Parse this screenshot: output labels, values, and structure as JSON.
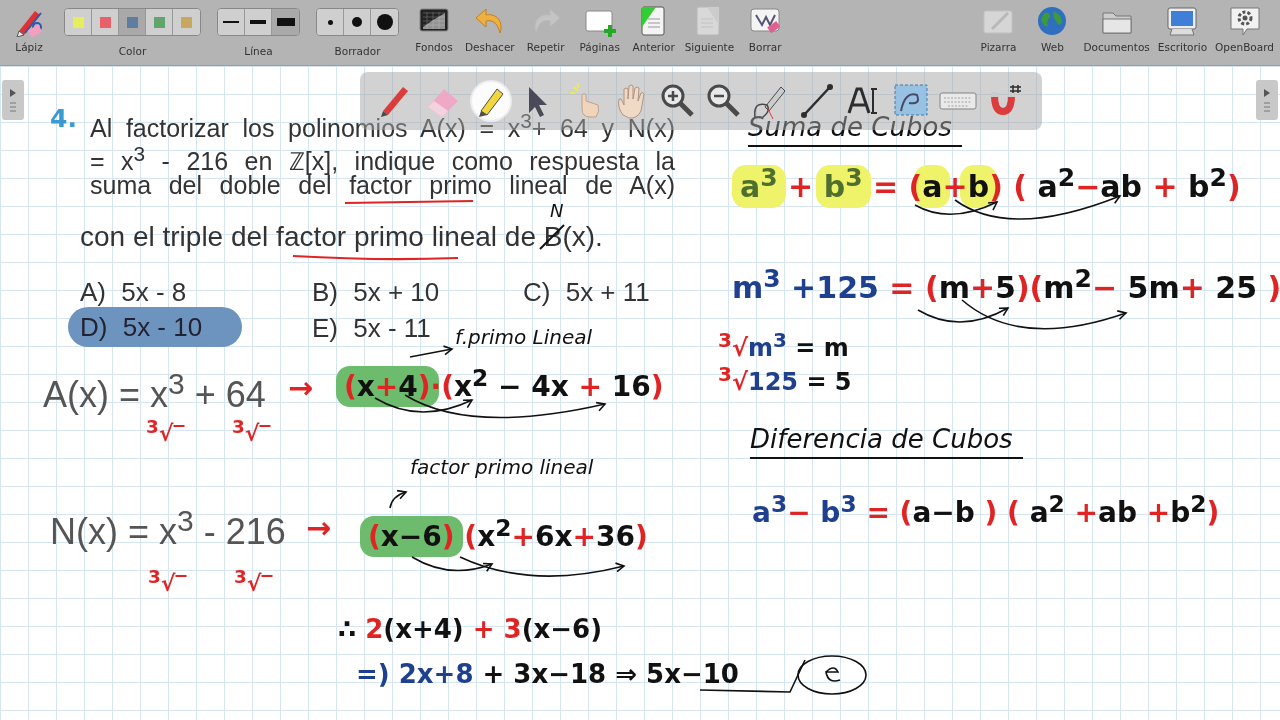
{
  "toolbar": {
    "left": [
      {
        "kind": "button",
        "label": "Lápiz",
        "disabled": false
      },
      {
        "kind": "colors",
        "label": "Color",
        "options": [
          {
            "color": "#e6ee5c",
            "selected": false
          },
          {
            "color": "#e8606a",
            "selected": false
          },
          {
            "color": "#5f7d9f",
            "selected": true
          },
          {
            "color": "#62a56c",
            "selected": false
          },
          {
            "color": "#c9a760",
            "selected": false
          }
        ]
      },
      {
        "kind": "line_widths",
        "label": "Línea",
        "options": [
          {
            "selected": false
          },
          {
            "selected": false
          },
          {
            "selected": true
          }
        ]
      },
      {
        "kind": "eraser_sizes",
        "label": "Borrador",
        "options": [
          {
            "selected": false
          },
          {
            "selected": false
          },
          {
            "selected": false
          }
        ]
      },
      {
        "kind": "button",
        "label": "Fondos",
        "disabled": false
      },
      {
        "kind": "button",
        "label": "Deshacer",
        "disabled": false
      },
      {
        "kind": "button",
        "label": "Repetir",
        "disabled": true
      },
      {
        "kind": "button",
        "label": "Páginas",
        "disabled": false
      },
      {
        "kind": "button",
        "label": "Anterior",
        "disabled": false
      },
      {
        "kind": "button",
        "label": "Siguiente",
        "disabled": true
      },
      {
        "kind": "button",
        "label": "Borrar",
        "disabled": false
      }
    ],
    "right": [
      {
        "kind": "button",
        "label": "Pizarra",
        "disabled": true
      },
      {
        "kind": "button",
        "label": "Web",
        "disabled": false
      },
      {
        "kind": "button",
        "label": "Documentos",
        "disabled": false
      },
      {
        "kind": "button",
        "label": "Escritorio",
        "disabled": false
      },
      {
        "kind": "button",
        "label": "OpenBoard",
        "disabled": false
      }
    ]
  },
  "tools": [
    {
      "selected": false
    },
    {
      "selected": false
    },
    {
      "selected": true
    },
    {
      "selected": false
    },
    {
      "selected": false
    },
    {
      "selected": false
    },
    {
      "selected": false
    },
    {
      "selected": false
    },
    {
      "selected": false
    },
    {
      "selected": false
    },
    {
      "selected": false
    },
    {
      "selected": false
    },
    {
      "selected": false
    },
    {
      "selected": false
    }
  ],
  "question": {
    "number": "4.",
    "lines": [
      "Al factorizar los polinomios A(x) = x$^{3}$+ 64 y N(x)",
      "= x$^{3}$ - 216 en ℤ[x], indique como respuesta la",
      "suma del doble del factor primo lineal de A(x)",
      "con el triple del factor primo lineal de B(x)."
    ]
  },
  "options": [
    {
      "letter": "A)",
      "text": "5x - 8",
      "selected": false
    },
    {
      "letter": "B)",
      "text": "5x + 10",
      "selected": false
    },
    {
      "letter": "C)",
      "text": "5x + 11",
      "selected": false
    },
    {
      "letter": "D)",
      "text": "5x - 10",
      "selected": true
    },
    {
      "letter": "E)",
      "text": "5x - 11",
      "selected": false
    }
  ],
  "ink": [
    {
      "kind": "note",
      "parts": [
        {
          "text": "N",
          "color": "#111111"
        }
      ]
    },
    {
      "kind": "note",
      "parts": [
        {
          "text": "f.primo Lineal",
          "color": "#111111"
        }
      ]
    },
    {
      "kind": "printed",
      "text": "A(x) = x$^{3}$ + 64"
    },
    {
      "kind": "math",
      "parts": [
        {
          "text": "→",
          "color": "#e02424"
        }
      ]
    },
    {
      "kind": "math",
      "parts": [
        {
          "text": "(",
          "color": "#e02424"
        },
        {
          "text": "x",
          "color": "#111111"
        },
        {
          "text": "+",
          "color": "#e02424"
        },
        {
          "text": "4",
          "color": "#111111"
        },
        {
          "text": ")",
          "color": "#e02424"
        },
        {
          "text": "·(",
          "color": "#e02424"
        },
        {
          "text": "x$^{2}$ − 4x ",
          "color": "#111111"
        },
        {
          "text": "+",
          "color": "#e02424"
        },
        {
          "text": " 16",
          "color": "#111111"
        },
        {
          "text": ")",
          "color": "#e02424"
        }
      ]
    },
    {
      "kind": "math",
      "parts": [
        {
          "text": "$^{3}$√‾",
          "color": "#e02424"
        }
      ]
    },
    {
      "kind": "math",
      "parts": [
        {
          "text": "$^{3}$√‾",
          "color": "#e02424"
        }
      ]
    },
    {
      "kind": "note",
      "parts": [
        {
          "text": "factor primo lineal",
          "color": "#111111"
        }
      ]
    },
    {
      "kind": "printed",
      "text": "N(x) = x$^{3}$ - 216"
    },
    {
      "kind": "math",
      "parts": [
        {
          "text": "→",
          "color": "#e02424"
        }
      ]
    },
    {
      "kind": "math",
      "parts": [
        {
          "text": "(",
          "color": "#e02424"
        },
        {
          "text": "x−6",
          "color": "#111111"
        },
        {
          "text": ")",
          "color": "#e02424"
        },
        {
          "text": " (",
          "color": "#e02424"
        },
        {
          "text": "x$^{2}$",
          "color": "#111111"
        },
        {
          "text": "+",
          "color": "#e02424"
        },
        {
          "text": "6x",
          "color": "#111111"
        },
        {
          "text": "+",
          "color": "#e02424"
        },
        {
          "text": "36",
          "color": "#111111"
        },
        {
          "text": ")",
          "color": "#e02424"
        }
      ]
    },
    {
      "kind": "math",
      "parts": [
        {
          "text": "$^{3}$√‾",
          "color": "#e02424"
        }
      ]
    },
    {
      "kind": "math",
      "parts": [
        {
          "text": "$^{3}$√‾",
          "color": "#e02424"
        }
      ]
    },
    {
      "kind": "math",
      "parts": [
        {
          "text": "∴ ",
          "color": "#111111"
        },
        {
          "text": "2",
          "color": "#e02424"
        },
        {
          "text": "(x+4) ",
          "color": "#111111"
        },
        {
          "text": "+ 3",
          "color": "#e02424"
        },
        {
          "text": "(x−6)",
          "color": "#111111"
        }
      ]
    },
    {
      "kind": "math",
      "parts": [
        {
          "text": "=) ",
          "color": "#1f3f8f"
        },
        {
          "text": "2x+8",
          "color": "#1f3f8f"
        },
        {
          "text": " + 3x−18",
          "color": "#111111"
        },
        {
          "text": "   ⇒ 5x−10",
          "color": "#111111"
        }
      ]
    },
    {
      "kind": "heading",
      "parts": [
        {
          "text": "Suma de Cubos",
          "color": "#111111"
        }
      ]
    },
    {
      "kind": "math",
      "parts": [
        {
          "text": "a$^{3}$",
          "color": "#4f6f2f"
        },
        {
          "text": " + ",
          "color": "#e02424"
        },
        {
          "text": "b$^{3}$",
          "color": "#4f6f2f"
        },
        {
          "text": " = (",
          "color": "#e02424"
        },
        {
          "text": "a",
          "color": "#111111"
        },
        {
          "text": "+",
          "color": "#e02424"
        },
        {
          "text": "b",
          "color": "#111111"
        },
        {
          "text": ") ( ",
          "color": "#e02424"
        },
        {
          "text": "a$^{2}$",
          "color": "#111111"
        },
        {
          "text": "−",
          "color": "#e02424"
        },
        {
          "text": "ab ",
          "color": "#111111"
        },
        {
          "text": "+ ",
          "color": "#e02424"
        },
        {
          "text": "b$^{2}$",
          "color": "#111111"
        },
        {
          "text": ")",
          "color": "#e02424"
        }
      ]
    },
    {
      "kind": "math",
      "parts": [
        {
          "text": "m$^{3}$ +125",
          "color": "#1f3f8f"
        },
        {
          "text": "  = (",
          "color": "#e02424"
        },
        {
          "text": "m",
          "color": "#111111"
        },
        {
          "text": "+",
          "color": "#e02424"
        },
        {
          "text": "5",
          "color": "#111111"
        },
        {
          "text": ")(",
          "color": "#e02424"
        },
        {
          "text": "m$^{2}$",
          "color": "#111111"
        },
        {
          "text": "−",
          "color": "#e02424"
        },
        {
          "text": " 5m",
          "color": "#111111"
        },
        {
          "text": "+",
          "color": "#e02424"
        },
        {
          "text": " 25 ",
          "color": "#111111"
        },
        {
          "text": ")",
          "color": "#e02424"
        }
      ]
    },
    {
      "kind": "math",
      "parts": [
        {
          "text": "$^{3}$√",
          "color": "#e02424"
        },
        {
          "text": "m$^{3}$",
          "color": "#1f3f8f"
        },
        {
          "text": " = m",
          "color": "#111111"
        }
      ]
    },
    {
      "kind": "math",
      "parts": [
        {
          "text": "$^{3}$√",
          "color": "#e02424"
        },
        {
          "text": "125",
          "color": "#1f3f8f"
        },
        {
          "text": " = 5",
          "color": "#111111"
        }
      ]
    },
    {
      "kind": "heading",
      "parts": [
        {
          "text": "Diferencia de Cubos",
          "color": "#111111"
        }
      ]
    },
    {
      "kind": "math",
      "parts": [
        {
          "text": "a$^{3}$",
          "color": "#1f3f8f"
        },
        {
          "text": "−  ",
          "color": "#e02424"
        },
        {
          "text": "b$^{3}$",
          "color": "#1f3f8f"
        },
        {
          "text": " = (",
          "color": "#e02424"
        },
        {
          "text": "a−b ",
          "color": "#111111"
        },
        {
          "text": ") ( ",
          "color": "#e02424"
        },
        {
          "text": "a$^{2}$ ",
          "color": "#111111"
        },
        {
          "text": "+",
          "color": "#e02424"
        },
        {
          "text": "ab ",
          "color": "#111111"
        },
        {
          "text": "+",
          "color": "#e02424"
        },
        {
          "text": "b$^{2}$",
          "color": "#111111"
        },
        {
          "text": ")",
          "color": "#e02424"
        }
      ]
    }
  ],
  "highlighter_marks": [
    {
      "color": "#6dbb6d"
    },
    {
      "color": "#6dbb6d"
    },
    {
      "color": "#eef36a"
    },
    {
      "color": "#eef36a"
    },
    {
      "color": "#eef36a"
    },
    {
      "color": "#eef36a"
    }
  ]
}
